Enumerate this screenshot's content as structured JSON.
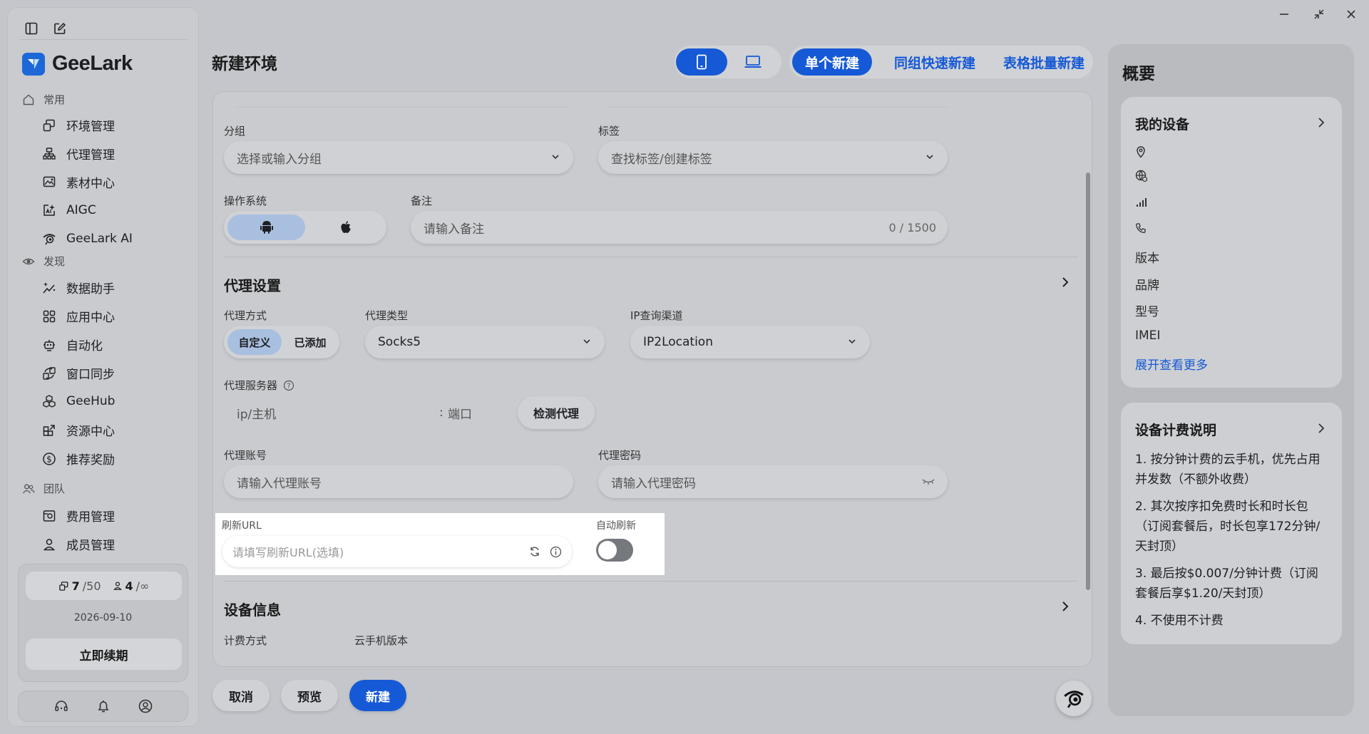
{
  "window": {
    "minimize": "–",
    "restore": "⤡",
    "close": "✕"
  },
  "sidebar": {
    "brand": "GeeLark",
    "sections": [
      {
        "label": "常用",
        "items": [
          "环境管理",
          "代理管理",
          "素材中心",
          "AIGC",
          "GeeLark AI"
        ]
      },
      {
        "label": "发现",
        "items": [
          "数据助手",
          "应用中心",
          "自动化",
          "窗口同步",
          "GeeHub",
          "资源中心",
          "推荐奖励"
        ]
      },
      {
        "label": "团队",
        "items": [
          "费用管理",
          "成员管理"
        ]
      }
    ],
    "env_count": "7",
    "env_total": "/50",
    "member_count": "4",
    "member_total": "/∞",
    "date": "2026-09-10",
    "renew_label": "立即续期"
  },
  "header": {
    "title": "新建环境",
    "device_modes": [
      "phone-icon",
      "laptop-icon"
    ],
    "tabs": [
      "单个新建",
      "同组快速新建",
      "表格批量新建"
    ],
    "active_tab": 0
  },
  "form": {
    "group_label": "分组",
    "group_placeholder": "选择或输入分组",
    "tag_label": "标签",
    "tag_placeholder": "查找标签/创建标签",
    "os_label": "操作系统",
    "os_options": [
      "android-icon",
      "apple-icon"
    ],
    "note_label": "备注",
    "note_placeholder": "请输入备注",
    "note_counter": "0 / 1500",
    "proxy_section": "代理设置",
    "proxy_mode_label": "代理方式",
    "proxy_modes": [
      "自定义",
      "已添加"
    ],
    "proxy_type_label": "代理类型",
    "proxy_type_value": "Socks5",
    "ip_channel_label": "IP查询渠道",
    "ip_channel_value": "IP2Location",
    "proxy_server_label": "代理服务器",
    "host_placeholder": "ip/主机",
    "port_placeholder": "端口",
    "check_proxy": "检测代理",
    "account_label": "代理账号",
    "account_placeholder": "请输入代理账号",
    "password_label": "代理密码",
    "password_placeholder": "请输入代理密码",
    "refresh_url_label": "刷新URL",
    "refresh_url_placeholder": "请填写刷新URL(选填)",
    "auto_refresh_label": "自动刷新",
    "auto_refresh_on": false,
    "device_section": "设备信息",
    "billing_label": "计费方式",
    "cloud_version_label": "云手机版本"
  },
  "actions": {
    "cancel": "取消",
    "preview": "预览",
    "create": "新建"
  },
  "summary": {
    "title": "概要",
    "my_device": {
      "title": "我的设备",
      "rows": [
        "版本",
        "品牌",
        "型号",
        "IMEI"
      ],
      "more": "展开查看更多"
    },
    "billing": {
      "title": "设备计费说明",
      "items": [
        "1. 按分钟计费的云手机，优先占用并发数（不额外收费）",
        "2. 其次按序扣免费时长和时长包（订阅套餐后，时长包享172分钟/天封顶）",
        "3. 最后按$0.007/分钟计费（订阅套餐后享$1.20/天封顶）",
        "4. 不使用不计费"
      ]
    }
  },
  "colors": {
    "accent": "#1559d6",
    "panel": "#c9cbcf",
    "background": "#c4c6cb"
  }
}
